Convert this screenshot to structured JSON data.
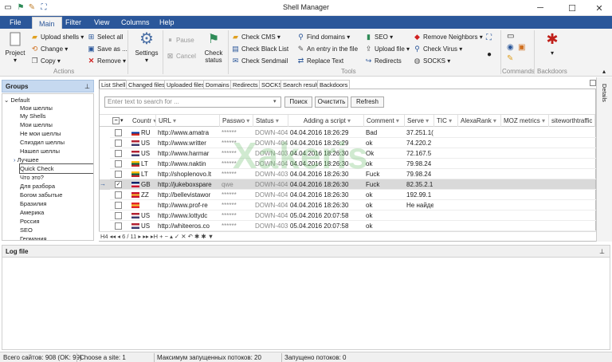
{
  "window": {
    "title": "Shell Manager"
  },
  "menu": [
    "File",
    "Main",
    "Filter",
    "View",
    "Columns",
    "Help"
  ],
  "ribbon": {
    "project": "Project",
    "upload_shells": "Upload shells",
    "select_all": "Select all",
    "change": "Change",
    "save_as": "Save as ...",
    "copy": "Copy",
    "remove": "Remove",
    "actions_label": "Actions",
    "settings": "Settings",
    "pause": "Pause",
    "cancel": "Cancel",
    "check_status_1": "Check",
    "check_status_2": "status",
    "check_cms": "Check CMS",
    "check_black_list": "Check Black List",
    "check_sendmail": "Check Sendmail",
    "find_domains": "Find domains",
    "an_entry": "An entry in the file",
    "replace_text": "Replace Text",
    "seo": "SEO",
    "upload_file": "Upload file",
    "redirects": "Redirects",
    "remove_neighbors": "Remove Neighbors",
    "check_virus": "Check Virus",
    "socks": "SOCKS",
    "tools_label": "Tools",
    "commands_label": "Commands",
    "backdoors_label": "Backdoors"
  },
  "groups": {
    "title": "Groups",
    "items": [
      "Default",
      "Мои шеллы",
      "My Shells",
      "Мои шеллы",
      "Не мои шеллы",
      "Спиздил шеллы",
      "Нашел шеллы",
      "Лучшее",
      "Quick Check",
      "Что это?",
      "Для разбора",
      "Богом забытые",
      "Бразилия",
      "Америка",
      "Россия",
      "SEO",
      "Германия"
    ]
  },
  "tabs": [
    "List Shell",
    "Changed files",
    "Uploaded files",
    "Domains",
    "Redirects",
    "SOCKS",
    "Search result",
    "Backdoors"
  ],
  "search": {
    "placeholder": "Enter text to search for ...",
    "search_btn": "Поиск",
    "clear_btn": "Очистить",
    "refresh_btn": "Refresh"
  },
  "columns": [
    "Countr",
    "URL",
    "Passwo",
    "Status",
    "Adding a script",
    "Comment",
    "Serve",
    "TIC",
    "AlexaRank",
    "MOZ metrics",
    "siteworthtraffic"
  ],
  "rows": [
    {
      "country": "RU",
      "flag": [
        "#ffffff",
        "#0039a6",
        "#d52b1e"
      ],
      "url": "http://www.amatra",
      "pass": "******",
      "status": "DOWN-404",
      "added": "04.04.2016 18:26:29",
      "comment": "Bad",
      "server": "37.251.1("
    },
    {
      "country": "US",
      "flag": [
        "#b22234",
        "#ffffff",
        "#3c3b6e"
      ],
      "url": "http://www.writter",
      "pass": "******",
      "status": "DOWN-404",
      "added": "04.04.2016 18:26:29",
      "comment": "ok",
      "server": "74.220.2"
    },
    {
      "country": "US",
      "flag": [
        "#b22234",
        "#ffffff",
        "#3c3b6e"
      ],
      "url": "http://www.harmar",
      "pass": "******",
      "status": "DOWN-403",
      "added": "04.04.2016 18:26:30",
      "comment": "Ok",
      "server": "72.167.5"
    },
    {
      "country": "LT",
      "flag": [
        "#fdb913",
        "#006a44",
        "#c1272d"
      ],
      "url": "http://www.naktin",
      "pass": "******",
      "status": "DOWN-404",
      "added": "04.04.2016 18:26:30",
      "comment": "ok",
      "server": "79.98.24"
    },
    {
      "country": "LT",
      "flag": [
        "#fdb913",
        "#006a44",
        "#c1272d"
      ],
      "url": "http://shoplenovo.lt",
      "pass": "******",
      "status": "DOWN-403",
      "added": "04.04.2016 18:26:30",
      "comment": "Fuck",
      "server": "79.98.24"
    },
    {
      "country": "GB",
      "flag": [
        "#012169",
        "#ffffff",
        "#c8102e"
      ],
      "url": "http://jukeboxspare",
      "pass": "qwe",
      "status": "DOWN-404",
      "added": "04.04.2016 18:26:30",
      "comment": "Fuck",
      "server": "82.35.2.1"
    },
    {
      "country": "ZZ",
      "flag": [
        "#c8102e",
        "#f4c430",
        "#c8102e"
      ],
      "url": "http://bellevistawor",
      "pass": "******",
      "status": "DOWN-404",
      "added": "04.04.2016 18:26:30",
      "comment": "ok",
      "server": "192.99.1"
    },
    {
      "country": "",
      "flag": [
        "#e3242b",
        "#f4c430",
        "#e3242b"
      ],
      "url": "http://www.prof-re",
      "pass": "******",
      "status": "DOWN-404",
      "added": "04.04.2016 18:26:30",
      "comment": "ok",
      "server": "Не найде"
    },
    {
      "country": "US",
      "flag": [
        "#b22234",
        "#ffffff",
        "#3c3b6e"
      ],
      "url": "http://www.lottydc",
      "pass": "******",
      "status": "DOWN-404",
      "added": "05.04.2016 20:07:58",
      "comment": "ok",
      "server": ""
    },
    {
      "country": "US",
      "flag": [
        "#b22234",
        "#ffffff",
        "#3c3b6e"
      ],
      "url": "http://whiteeros.co",
      "pass": "******",
      "status": "DOWN-403",
      "added": "05.04.2016 20:07:58",
      "comment": "ok",
      "server": ""
    }
  ],
  "watermark": "Xakeris",
  "pager": "H4 ◂◂ ◂  6 / 11  ▸ ▸▸ ▸H  +  −  ▴  ✓  ✕  ↶  ✱  ✱  ▼",
  "details_label": "Details",
  "log": {
    "title": "Log file"
  },
  "status": {
    "total": "Всего сайтов: 908 (OK: 99)",
    "choose": "Choose a site: 1",
    "max_threads": "Максимум запущенных потоков: 20",
    "running": "Запущено потоков: 0"
  },
  "colors": {
    "menubar": "#2b579a",
    "selected_row": "#d9d9d9",
    "watermark": "#6ebe6e"
  }
}
